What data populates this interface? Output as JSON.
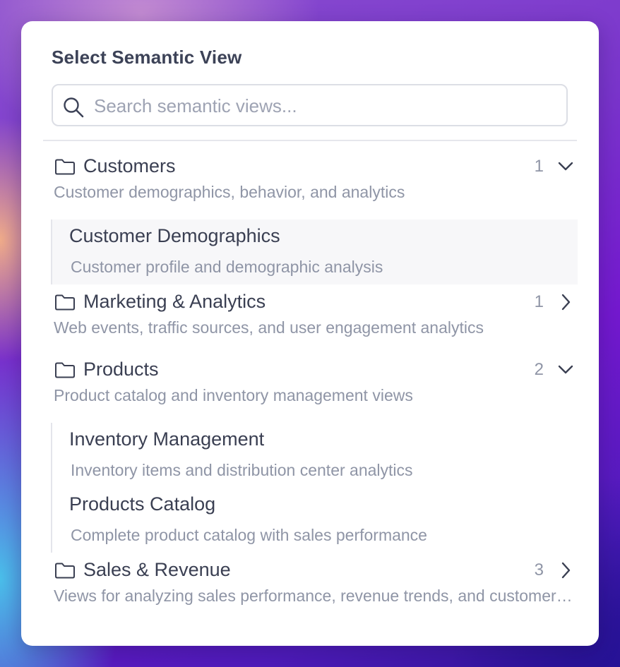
{
  "dialog": {
    "title": "Select Semantic View",
    "search": {
      "placeholder": "Search semantic views...",
      "value": ""
    }
  },
  "groups": [
    {
      "name": "Customers",
      "count": "1",
      "expanded": true,
      "description": "Customer demographics, behavior, and analytics",
      "views": [
        {
          "name": "Customer Demographics",
          "description": "Customer profile and demographic analysis",
          "highlighted": true
        }
      ]
    },
    {
      "name": "Marketing & Analytics",
      "count": "1",
      "expanded": false,
      "description": "Web events, traffic sources, and user engagement analytics",
      "views": []
    },
    {
      "name": "Products",
      "count": "2",
      "expanded": true,
      "description": "Product catalog and inventory management views",
      "views": [
        {
          "name": "Inventory Management",
          "description": "Inventory items and distribution center analytics"
        },
        {
          "name": "Products Catalog",
          "description": "Complete product catalog with sales performance"
        }
      ]
    },
    {
      "name": "Sales & Revenue",
      "count": "3",
      "expanded": false,
      "description": "Views for analyzing sales performance, revenue trends, and customer metrics",
      "views": []
    }
  ],
  "icons": {
    "search": "search-icon",
    "folder": "folder-icon",
    "expanded": "chevron-down-icon",
    "collapsed": "chevron-right-icon"
  },
  "colors": {
    "text_primary": "#3a3f52",
    "text_secondary": "#8f95a6",
    "border": "#dcdee5",
    "highlight_bg": "#f7f7f9"
  }
}
